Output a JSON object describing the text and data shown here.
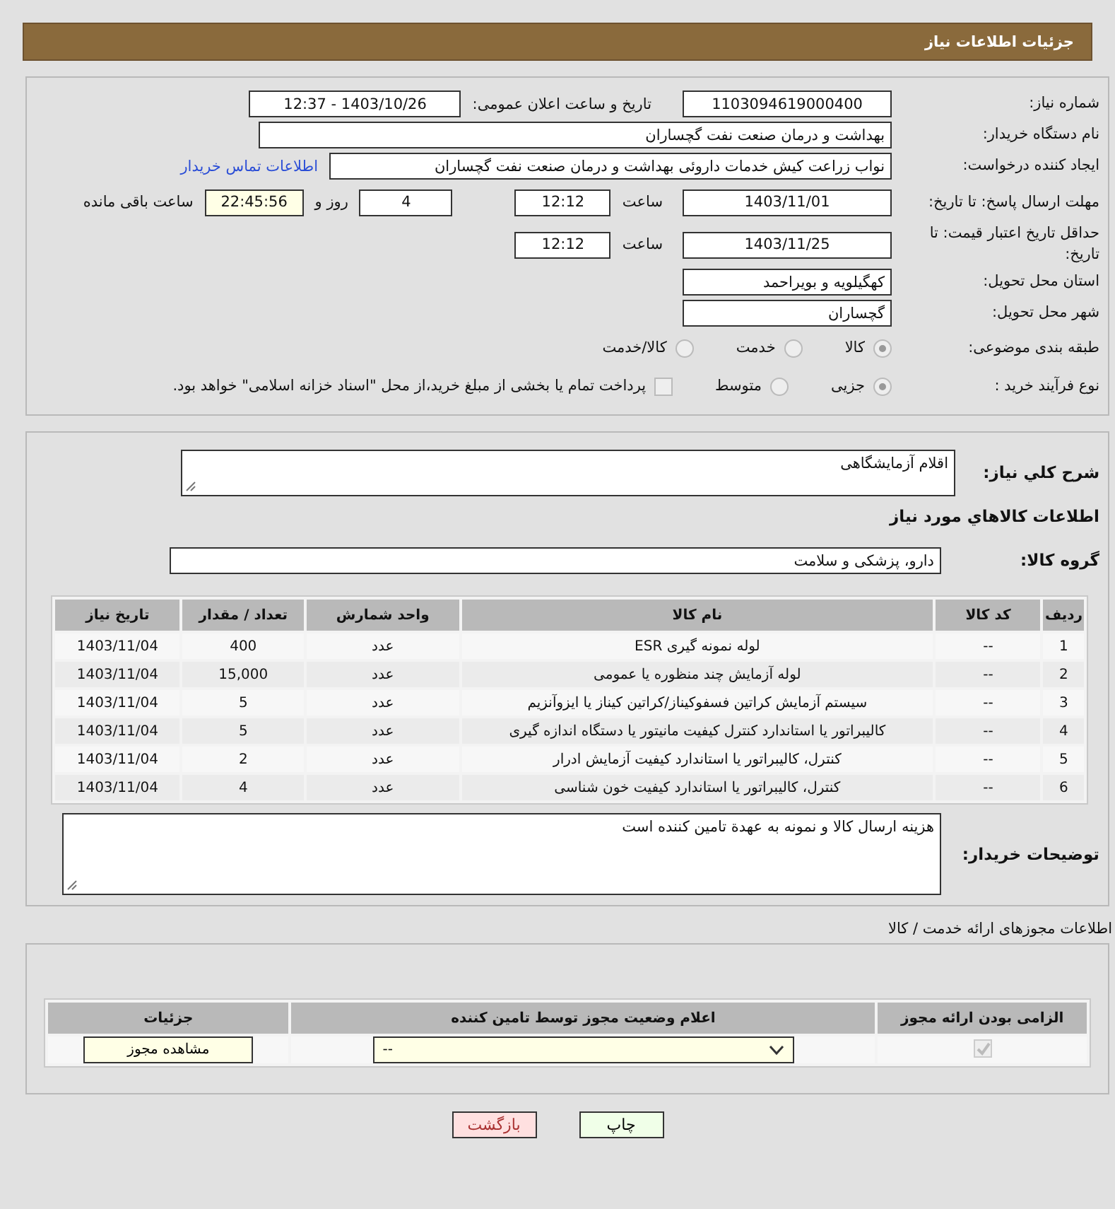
{
  "header": {
    "title": "جزئیات اطلاعات نیاز"
  },
  "need_number": {
    "label": "شماره نیاز:",
    "value": "1103094619000400"
  },
  "announce_datetime": {
    "label": "تاریخ و ساعت اعلان عمومی:",
    "value": "1403/10/26 - 12:37"
  },
  "buyer_org": {
    "label": "نام دستگاه خریدار:",
    "value": "بهداشت و درمان صنعت نفت گچساران"
  },
  "requester": {
    "label": "ایجاد کننده درخواست:",
    "value": "نواب زراعت کیش خدمات داروئی بهداشت و درمان صنعت نفت گچساران",
    "link": "اطلاعات تماس خریدار"
  },
  "response_deadline": {
    "label": "مهلت ارسال پاسخ: تا تاریخ:",
    "date": "1403/11/01",
    "time_label": "ساعت",
    "time": "12:12",
    "days": "4",
    "days_label": "روز و",
    "remaining": "22:45:56",
    "remaining_label": "ساعت باقی مانده"
  },
  "price_validity": {
    "label": "حداقل تاریخ اعتبار قیمت: تا تاریخ:",
    "date": "1403/11/25",
    "time_label": "ساعت",
    "time": "12:12"
  },
  "province": {
    "label": "استان محل تحویل:",
    "value": "کهگیلویه و بویراحمد"
  },
  "city": {
    "label": "شهر محل تحویل:",
    "value": "گچساران"
  },
  "category": {
    "label": "طبقه بندی موضوعی:",
    "options": [
      {
        "label": "کالا",
        "selected": true
      },
      {
        "label": "خدمت",
        "selected": false
      },
      {
        "label": "کالا/خدمت",
        "selected": false
      }
    ]
  },
  "purchase_type": {
    "label": "نوع فرآیند خرید :",
    "options": [
      {
        "label": "جزیی",
        "selected": true
      },
      {
        "label": "متوسط",
        "selected": false
      }
    ],
    "treasury": {
      "label": "پرداخت تمام یا بخشی از مبلغ خرید،از محل \"اسناد خزانه اسلامی\" خواهد بود.",
      "checked": false
    }
  },
  "general_description": {
    "label": "شرح کلي نياز:",
    "value": "اقلام آزمایشگاهی"
  },
  "items_heading": "اطلاعات کالاهاي مورد نياز",
  "goods_group": {
    "label": "گروه کالا:",
    "value": "دارو، پزشکی و سلامت"
  },
  "items_table": {
    "columns": [
      "ردیف",
      "کد کالا",
      "نام کالا",
      "واحد شمارش",
      "تعداد / مقدار",
      "تاریخ نیاز"
    ],
    "rows": [
      [
        "1",
        "--",
        "لوله نمونه گیری ESR",
        "عدد",
        "400",
        "1403/11/04"
      ],
      [
        "2",
        "--",
        "لوله آزمایش چند منظوره یا عمومی",
        "عدد",
        "15,000",
        "1403/11/04"
      ],
      [
        "3",
        "--",
        "سیستم آزمایش کراتین فسفوکیناز/کراتین کیناز یا ایزوآنزیم",
        "عدد",
        "5",
        "1403/11/04"
      ],
      [
        "4",
        "--",
        "کالیبراتور یا استاندارد کنترل کیفیت مانیتور یا دستگاه اندازه گیری",
        "عدد",
        "5",
        "1403/11/04"
      ],
      [
        "5",
        "--",
        "کنترل، کالیبراتور یا استاندارد کیفیت آزمایش ادرار",
        "عدد",
        "2",
        "1403/11/04"
      ],
      [
        "6",
        "--",
        "کنترل، کالیبراتور یا استاندارد کیفیت خون شناسی",
        "عدد",
        "4",
        "1403/11/04"
      ]
    ]
  },
  "buyer_notes": {
    "label": "توضیحات خریدار:",
    "value": "هزینه ارسال کالا و نمونه به عهدة تامین کننده است"
  },
  "licenses": {
    "heading": "اطلاعات مجوزهای ارائه خدمت / کالا",
    "columns": [
      "الزامی بودن ارائه مجوز",
      "اعلام وضعیت مجوز توسط تامین کننده",
      "جزئیات"
    ],
    "rows": [
      {
        "required": true,
        "status": "--",
        "button": "مشاهده مجوز"
      }
    ]
  },
  "buttons": [
    {
      "label": "چاپ",
      "kind": "print"
    },
    {
      "label": "بازگشت",
      "kind": "back"
    }
  ]
}
